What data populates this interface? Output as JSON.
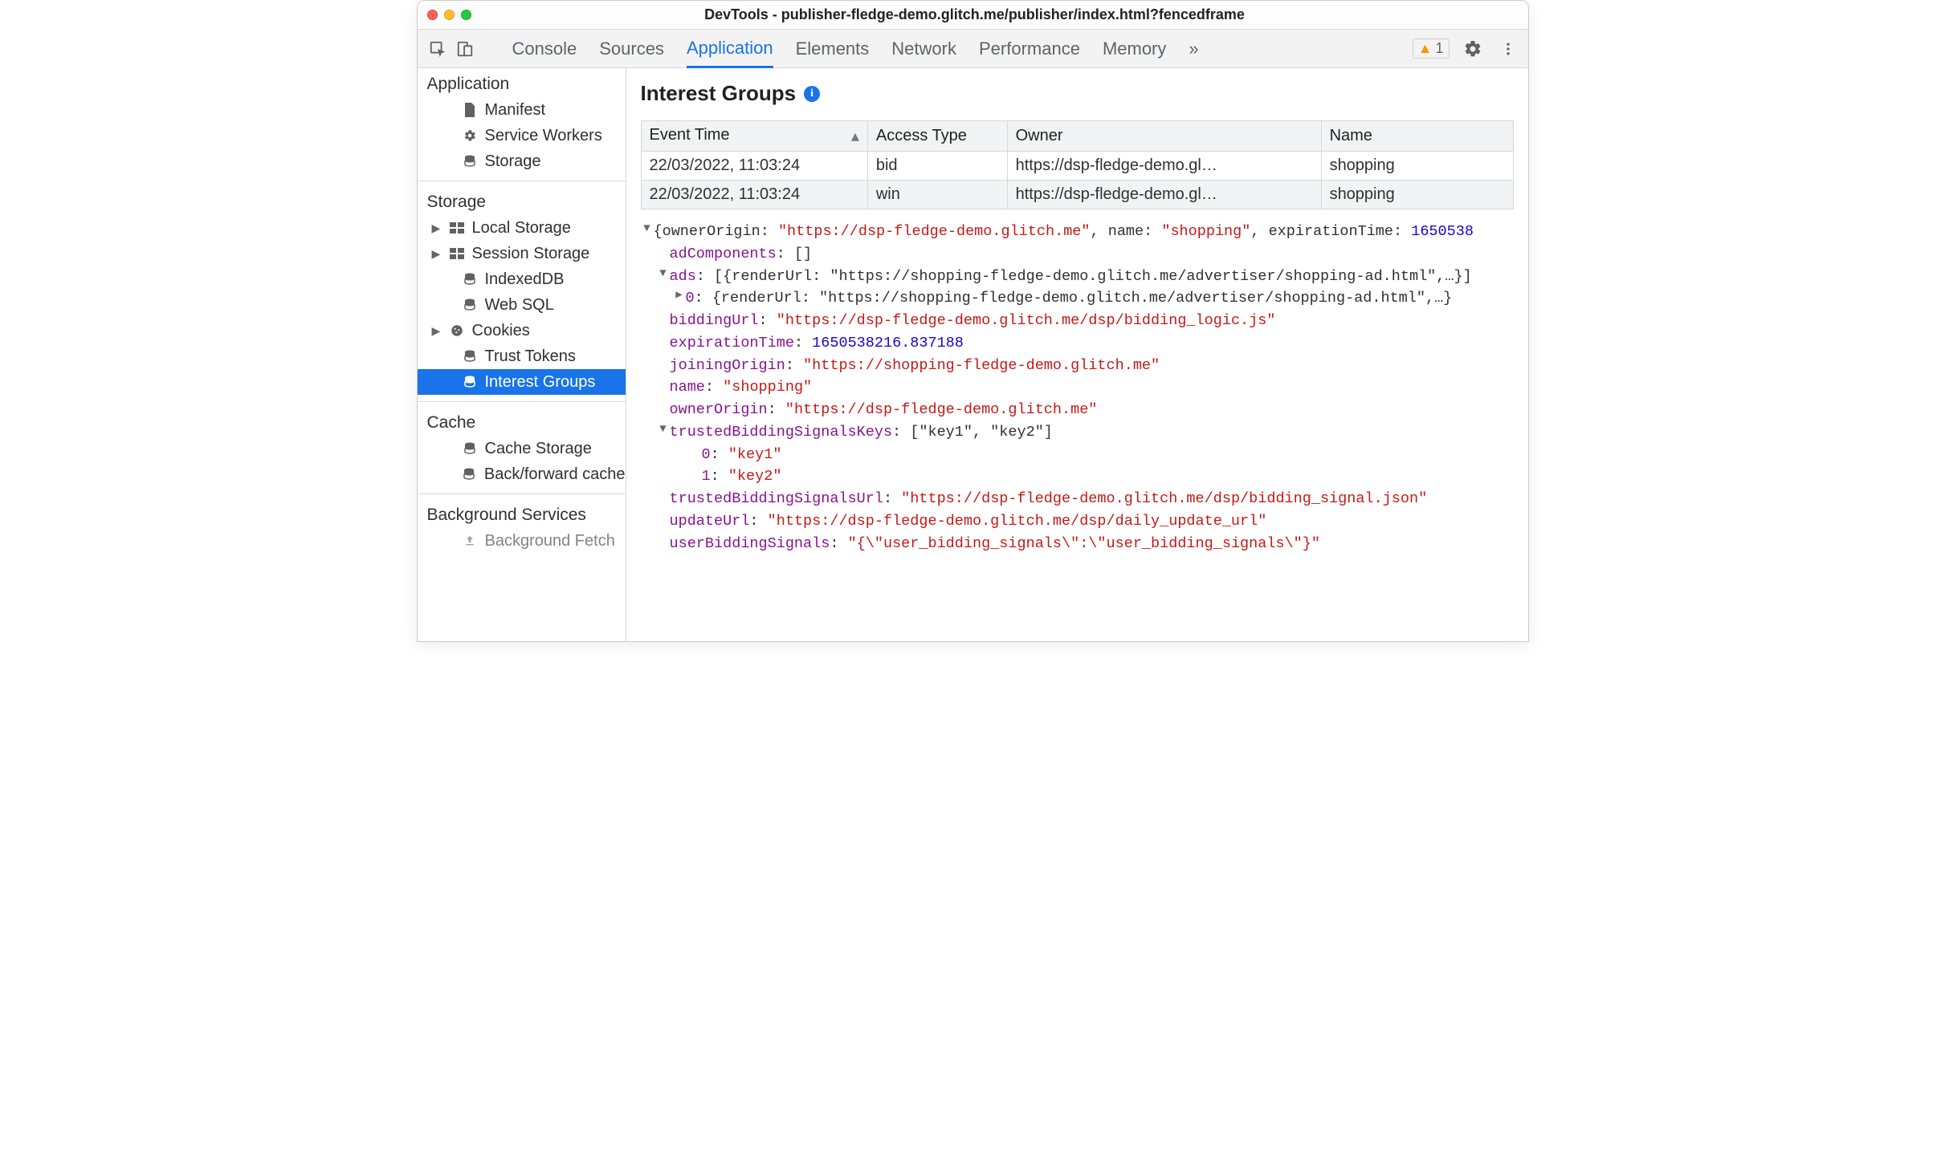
{
  "window": {
    "title": "DevTools - publisher-fledge-demo.glitch.me/publisher/index.html?fencedframe"
  },
  "toolbar": {
    "tabs": [
      "Console",
      "Sources",
      "Application",
      "Elements",
      "Network",
      "Performance",
      "Memory"
    ],
    "active_tab_index": 2,
    "overflow_glyph": "»",
    "warning_count": "1"
  },
  "sidebar": {
    "sections": {
      "application": {
        "label": "Application",
        "items": [
          {
            "label": "Manifest",
            "icon": "file-icon"
          },
          {
            "label": "Service Workers",
            "icon": "gear-icon"
          },
          {
            "label": "Storage",
            "icon": "database-icon"
          }
        ]
      },
      "storage": {
        "label": "Storage",
        "items": [
          {
            "label": "Local Storage",
            "icon": "table-icon",
            "expandable": true
          },
          {
            "label": "Session Storage",
            "icon": "table-icon",
            "expandable": true
          },
          {
            "label": "IndexedDB",
            "icon": "database-icon"
          },
          {
            "label": "Web SQL",
            "icon": "database-icon"
          },
          {
            "label": "Cookies",
            "icon": "cookie-icon",
            "expandable": true
          },
          {
            "label": "Trust Tokens",
            "icon": "database-icon"
          },
          {
            "label": "Interest Groups",
            "icon": "database-icon",
            "selected": true
          }
        ]
      },
      "cache": {
        "label": "Cache",
        "items": [
          {
            "label": "Cache Storage",
            "icon": "database-icon"
          },
          {
            "label": "Back/forward cache",
            "icon": "database-icon"
          }
        ]
      },
      "background": {
        "label": "Background Services",
        "items": [
          {
            "label": "Background Fetch",
            "icon": "upload-icon"
          }
        ]
      }
    }
  },
  "main": {
    "heading": "Interest Groups",
    "table": {
      "columns": [
        "Event Time",
        "Access Type",
        "Owner",
        "Name"
      ],
      "sort_col": 0,
      "rows": [
        {
          "time": "22/03/2022, 11:03:24",
          "access": "bid",
          "owner": "https://dsp-fledge-demo.gl…",
          "name": "shopping"
        },
        {
          "time": "22/03/2022, 11:03:24",
          "access": "win",
          "owner": "https://dsp-fledge-demo.gl…",
          "name": "shopping"
        }
      ]
    },
    "detail": {
      "summary_prefix": "{ownerOrigin: ",
      "summary_owner": "\"https://dsp-fledge-demo.glitch.me\"",
      "summary_mid": ", name: ",
      "summary_name": "\"shopping\"",
      "summary_mid2": ", expirationTime: ",
      "summary_exp": "1650538",
      "adComponents_key": "adComponents",
      "adComponents_val": "[]",
      "ads_key": "ads",
      "ads_summary": "[{renderUrl: \"https://shopping-fledge-demo.glitch.me/advertiser/shopping-ad.html\",…}]",
      "ads_0_idx": "0",
      "ads_0_val": "{renderUrl: \"https://shopping-fledge-demo.glitch.me/advertiser/shopping-ad.html\",…}",
      "biddingUrl_key": "biddingUrl",
      "biddingUrl_val": "\"https://dsp-fledge-demo.glitch.me/dsp/bidding_logic.js\"",
      "expirationTime_key": "expirationTime",
      "expirationTime_val": "1650538216.837188",
      "joiningOrigin_key": "joiningOrigin",
      "joiningOrigin_val": "\"https://shopping-fledge-demo.glitch.me\"",
      "name_key": "name",
      "name_val": "\"shopping\"",
      "ownerOrigin_key": "ownerOrigin",
      "ownerOrigin_val": "\"https://dsp-fledge-demo.glitch.me\"",
      "tbsk_key": "trustedBiddingSignalsKeys",
      "tbsk_summary": "[\"key1\", \"key2\"]",
      "tbsk_0_idx": "0",
      "tbsk_0_val": "\"key1\"",
      "tbsk_1_idx": "1",
      "tbsk_1_val": "\"key2\"",
      "tbsu_key": "trustedBiddingSignalsUrl",
      "tbsu_val": "\"https://dsp-fledge-demo.glitch.me/dsp/bidding_signal.json\"",
      "updateUrl_key": "updateUrl",
      "updateUrl_val": "\"https://dsp-fledge-demo.glitch.me/dsp/daily_update_url\"",
      "ubs_key": "userBiddingSignals",
      "ubs_val": "\"{\\\"user_bidding_signals\\\":\\\"user_bidding_signals\\\"}\""
    }
  }
}
